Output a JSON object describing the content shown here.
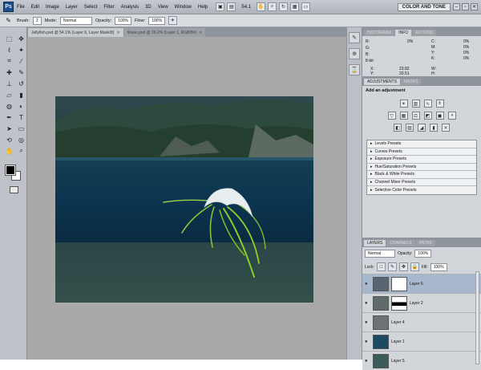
{
  "menubar": {
    "logo": "Ps",
    "items": [
      "File",
      "Edit",
      "Image",
      "Layer",
      "Select",
      "Filter",
      "Analysis",
      "3D",
      "View",
      "Window",
      "Help"
    ],
    "zoom": "54.1",
    "workspace": "COLOR AND TONE"
  },
  "options": {
    "brush_label": "Brush:",
    "brush_size": "2",
    "mode_label": "Mode:",
    "mode_value": "Normal",
    "opacity_label": "Opacity:",
    "opacity_value": "100%",
    "flow_label": "Flow:",
    "flow_value": "100%"
  },
  "tabs": [
    {
      "label": "Jellyfish.psd @ 54.1% (Layer 6, Layer Mask/8)",
      "active": true
    },
    {
      "label": "flower.psd @ 26.2% (Layer 1, RGB/8#)",
      "active": false
    }
  ],
  "info_panel": {
    "tabs": [
      "HISTOGRAM",
      "INFO",
      "ACTIONS"
    ],
    "rows": {
      "r": "R:",
      "g": "G:",
      "b": "B:",
      "bit": "8-bit",
      "x": "X:",
      "y": "Y:",
      "c": "C:",
      "m": "M:",
      "yc": "Y:",
      "k": "K:",
      "c_val": "0%",
      "m_val": "0%",
      "y_val": "0%",
      "k_val": "0%",
      "x_val": "23.82",
      "y_val2": "20.51",
      "w": "W:",
      "h": "H:",
      "pct": "0%"
    }
  },
  "adjustments": {
    "tabs": [
      "ADJUSTMENTS",
      "MASKS"
    ],
    "title": "Add an adjustment",
    "presets": [
      "Levels Presets",
      "Curves Presets",
      "Exposure Presets",
      "Hue/Saturation Presets",
      "Black & White Presets",
      "Channel Mixer Presets",
      "Selective Color Presets"
    ]
  },
  "layers": {
    "tabs": [
      "LAYERS",
      "CHANNELS",
      "PATHS"
    ],
    "blend": "Normal",
    "opacity_label": "Opacity:",
    "opacity": "100%",
    "lock_label": "Lock:",
    "fill_label": "Fill:",
    "fill": "100%",
    "items": [
      {
        "name": "Layer 6",
        "selected": true
      },
      {
        "name": "Layer 2",
        "selected": false
      },
      {
        "name": "Layer 4",
        "selected": false
      },
      {
        "name": "Layer 1",
        "selected": false
      },
      {
        "name": "Layer 5",
        "selected": false
      }
    ]
  }
}
